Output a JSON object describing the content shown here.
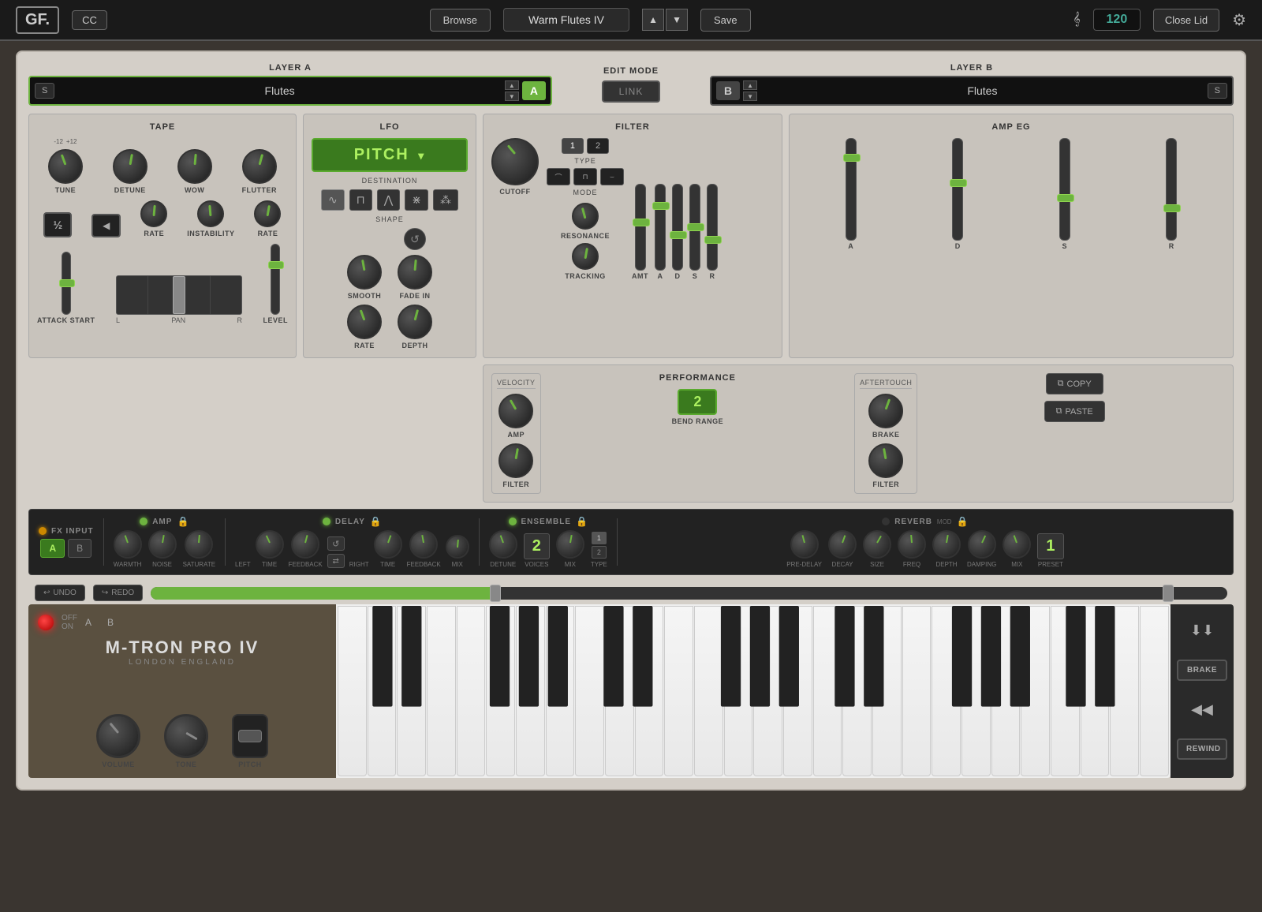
{
  "header": {
    "logo": "GF.",
    "cc_label": "CC",
    "browse_label": "Browse",
    "preset_name": "Warm Flutes IV",
    "save_label": "Save",
    "bpm": "120",
    "close_lid_label": "Close Lid"
  },
  "layer_a": {
    "title": "LAYER A",
    "s_label": "S",
    "name": "Flutes",
    "a_badge": "A"
  },
  "layer_b": {
    "title": "LAYER B",
    "s_label": "S",
    "name": "Flutes",
    "b_badge": "B"
  },
  "edit_mode": {
    "title": "EDIT MODE",
    "link_label": "LINK"
  },
  "tape": {
    "title": "TAPE",
    "tune_label": "TUNE",
    "detune_label": "DETUNE",
    "wow_label": "WOW",
    "flutter_label": "FLUTTER",
    "half_speed_label": "1/2 SPEED",
    "reverse_label": "REVERSE",
    "rate_label": "RATE",
    "instability_label": "INSTABILITY",
    "rate2_label": "RATE",
    "attack_start_label": "ATTACK START",
    "level_label": "LEVEL",
    "pan_label": "PAN",
    "range_min": "-12",
    "range_max": "+12",
    "pan_l": "L",
    "pan_r": "R"
  },
  "lfo": {
    "title": "LFO",
    "destination_label": "DESTINATION",
    "destination_value": "PITCH",
    "shape_label": "SHAPE",
    "smooth_label": "SMOOTH",
    "fade_in_label": "FADE IN",
    "rate_label": "RATE",
    "depth_label": "DEPTH"
  },
  "filter": {
    "title": "FILTER",
    "type_label": "TYPE",
    "mode_label": "MODE",
    "type_1": "1",
    "type_2": "2",
    "cutoff_label": "CUTOFF",
    "resonance_label": "RESONANCE",
    "tracking_label": "TRACKING",
    "amt_label": "AMT",
    "a_label": "A",
    "d_label": "D",
    "s_label": "S",
    "r_label": "R"
  },
  "amp_eg": {
    "title": "AMP EG",
    "a_label": "A",
    "d_label": "D",
    "s_label": "S",
    "r_label": "R"
  },
  "performance": {
    "title": "PERFORMANCE",
    "velocity_label": "VELOCITY",
    "aftertouch_label": "AFTERTOUCH",
    "amp_label": "AMP",
    "filter_label": "FILTER",
    "bend_range_label": "BEND RANGE",
    "bend_range_value": "2",
    "brake_label": "BRAKE",
    "filter2_label": "FILTER",
    "copy_label": "COPY",
    "paste_label": "PASTE"
  },
  "fx": {
    "fx_input_label": "FX INPUT",
    "a_label": "A",
    "b_label": "B",
    "amp_label": "AMP",
    "warmth_label": "WARMTH",
    "noise_label": "NOISE",
    "saturate_label": "SATURATE",
    "delay_label": "DELAY",
    "left_label": "LEFT",
    "right_label": "RIGHT",
    "delay_time_label": "TIME",
    "delay_feedback_label": "FEEDBACK",
    "delay_time2_label": "TIME",
    "delay_feedback2_label": "FEEDBACK",
    "delay_mix_label": "MIX",
    "ensemble_label": "ENSEMBLE",
    "detune_label": "DETUNE",
    "voices_label": "VOICES",
    "voices_value": "2",
    "ens_mix_label": "MIX",
    "ens_type_label": "TYPE",
    "ens_type_1": "1",
    "ens_type_2": "2",
    "reverb_label": "REVERB",
    "reverb_mod_label": "MOD",
    "pre_delay_label": "PRE-DELAY",
    "decay_label": "DECAY",
    "size_label": "SIZE",
    "freq_label": "FREQ",
    "depth_label": "DEPTH",
    "damping_label": "DAMPING",
    "rev_mix_label": "MIX",
    "rev_preset_label": "PRESET",
    "rev_preset_value": "1"
  },
  "transport": {
    "undo_label": "UNDO",
    "redo_label": "REDO"
  },
  "instrument": {
    "brand": "M-TRON PRO IV",
    "location": "LONDON    ENGLAND",
    "volume_label": "VOLUME",
    "tone_label": "TONE",
    "pitch_label": "PITCH"
  },
  "side_controls": {
    "brake_label": "BRAKE",
    "rewind_label": "REWIND"
  }
}
